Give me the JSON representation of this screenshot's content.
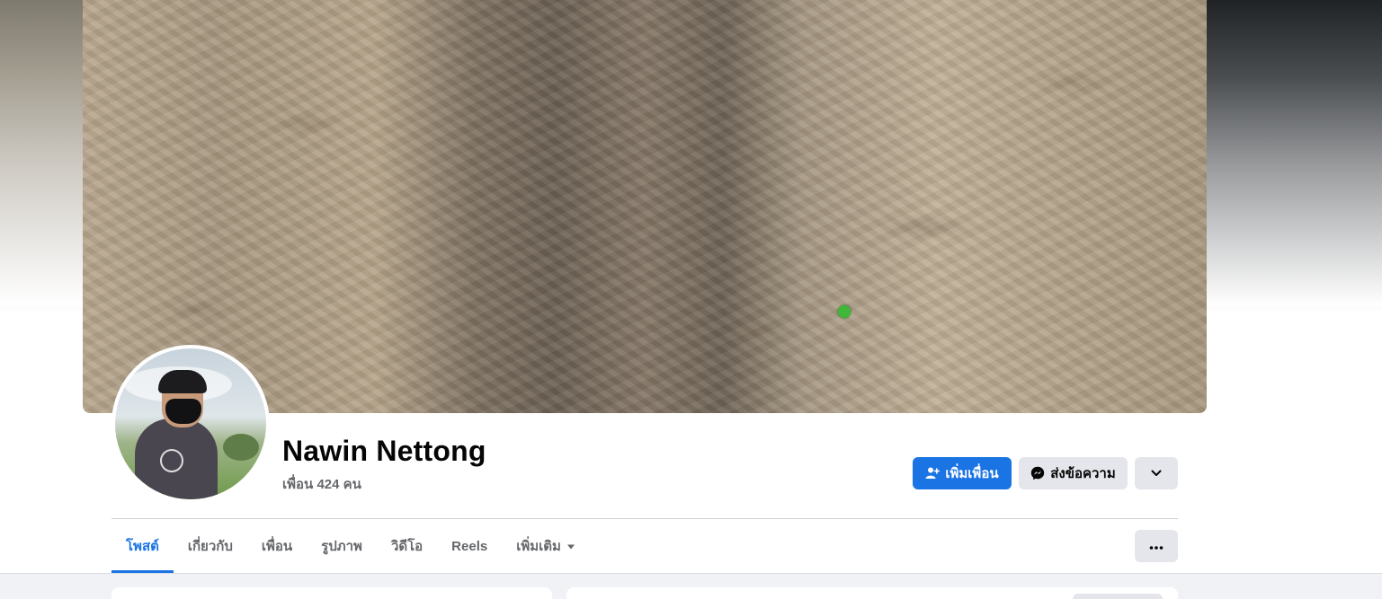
{
  "profile": {
    "name": "Nawin Nettong",
    "friends_count": "เพื่อน 424 คน"
  },
  "actions": {
    "add_friend": "เพิ่มเพื่อน",
    "message": "ส่งข้อความ"
  },
  "tabs": [
    {
      "label": "โพสต์",
      "active": true
    },
    {
      "label": "เกี่ยวกับ",
      "active": false
    },
    {
      "label": "เพื่อน",
      "active": false
    },
    {
      "label": "รูปภาพ",
      "active": false
    },
    {
      "label": "วิดีโอ",
      "active": false
    },
    {
      "label": "Reels",
      "active": false
    },
    {
      "label": "เพิ่มเติม",
      "active": false
    }
  ],
  "icons": {
    "add_friend": "add-person-icon",
    "message": "messenger-icon",
    "dropdown": "chevron-down-icon",
    "more_tab": "caret-down-icon",
    "ellipsis": "ellipsis-icon"
  },
  "colors": {
    "accent": "#1b74e4",
    "button_secondary": "#e4e6eb",
    "text_primary": "#050505",
    "text_secondary": "#65676b"
  }
}
